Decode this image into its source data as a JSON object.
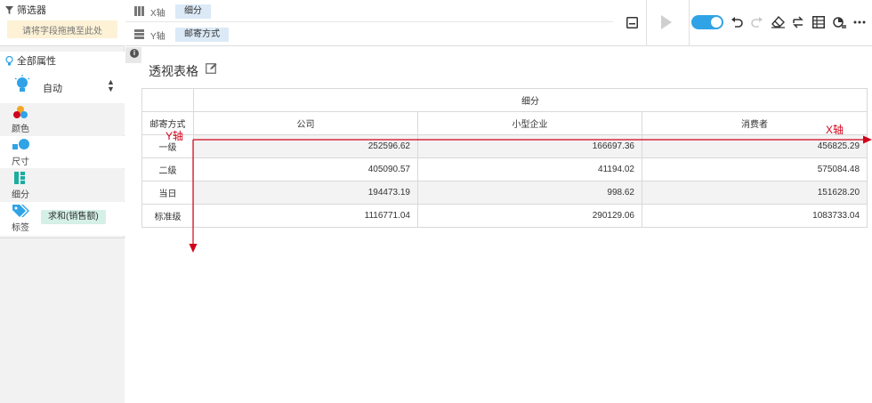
{
  "filter": {
    "title": "筛选器",
    "placeholder": "请将字段拖拽至此处"
  },
  "properties": {
    "title": "全部属性",
    "mode_value": "自动",
    "rows": {
      "color": "颜色",
      "size": "尺寸",
      "detail": "细分",
      "tag": "标签"
    },
    "tag_field": "求和(销售额)"
  },
  "axes": {
    "x_label": "X轴",
    "x_field": "细分",
    "y_label": "Y轴",
    "y_field": "邮寄方式"
  },
  "toolbar": {
    "icons": [
      "save-icon",
      "play-icon",
      "auto-refresh-toggle",
      "undo-icon",
      "redo-icon",
      "eraser-icon",
      "swap-icon",
      "table-icon",
      "chart-switch-icon",
      "more-icon"
    ],
    "accent_color": "#2fa3e6"
  },
  "chart": {
    "title": "透视表格",
    "col_group": "细分",
    "row_header": "邮寄方式",
    "columns": [
      "公司",
      "小型企业",
      "消费者"
    ],
    "rows": [
      {
        "label": "一级",
        "values": [
          "252596.62",
          "166697.36",
          "456825.29"
        ]
      },
      {
        "label": "二级",
        "values": [
          "405090.57",
          "41194.02",
          "575084.48"
        ]
      },
      {
        "label": "当日",
        "values": [
          "194473.19",
          "998.62",
          "151628.20"
        ]
      },
      {
        "label": "标准级",
        "values": [
          "1116771.04",
          "290129.06",
          "1083733.04"
        ]
      }
    ]
  },
  "annotations": {
    "x_axis_label": "X轴",
    "y_axis_label": "Y轴",
    "color": "#d0021b"
  }
}
